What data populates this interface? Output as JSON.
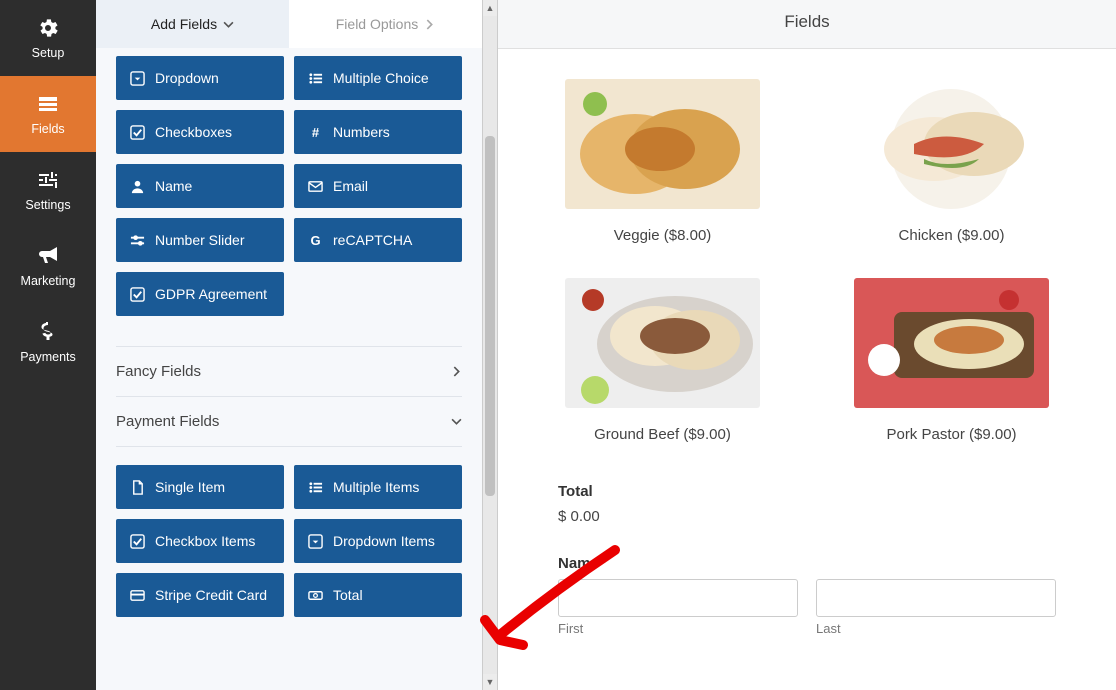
{
  "nav": [
    {
      "icon": "gear",
      "label": "Setup"
    },
    {
      "icon": "fields",
      "label": "Fields"
    },
    {
      "icon": "sliders",
      "label": "Settings"
    },
    {
      "icon": "bullhorn",
      "label": "Marketing"
    },
    {
      "icon": "dollar",
      "label": "Payments"
    }
  ],
  "tabs": {
    "add": "Add Fields",
    "options": "Field Options"
  },
  "field_buttons_top": [
    {
      "icon": "caret",
      "label": "Dropdown"
    },
    {
      "icon": "list",
      "label": "Multiple Choice"
    },
    {
      "icon": "check",
      "label": "Checkboxes"
    },
    {
      "icon": "hash",
      "label": "Numbers"
    },
    {
      "icon": "user",
      "label": "Name"
    },
    {
      "icon": "mail",
      "label": "Email"
    },
    {
      "icon": "slider",
      "label": "Number Slider"
    },
    {
      "icon": "g",
      "label": "reCAPTCHA"
    },
    {
      "icon": "check",
      "label": "GDPR Agreement"
    }
  ],
  "sections": {
    "fancy": "Fancy Fields",
    "payment": "Payment Fields"
  },
  "payment_buttons": [
    {
      "icon": "doc",
      "label": "Single Item"
    },
    {
      "icon": "list",
      "label": "Multiple Items"
    },
    {
      "icon": "check",
      "label": "Checkbox Items"
    },
    {
      "icon": "caret",
      "label": "Dropdown Items"
    },
    {
      "icon": "card",
      "label": "Stripe Credit Card"
    },
    {
      "icon": "money",
      "label": "Total"
    }
  ],
  "preview": {
    "title": "Fields",
    "items": [
      {
        "label": "Veggie ($8.00)",
        "colors": [
          "#e6b56a",
          "#c47a2e",
          "#8fbf4f"
        ]
      },
      {
        "label": "Chicken ($9.00)",
        "colors": [
          "#f5e9d6",
          "#d0b97e",
          "#cc5b3f"
        ]
      },
      {
        "label": "Ground Beef ($9.00)",
        "colors": [
          "#8a5a3b",
          "#6a9a4f",
          "#d7d2cc"
        ]
      },
      {
        "label": "Pork Pastor ($9.00)",
        "colors": [
          "#d33a3a",
          "#eadfb8",
          "#8a5a3b"
        ]
      }
    ],
    "total_label": "Total",
    "total_value": "$ 0.00",
    "name_label": "Name",
    "first_label": "First",
    "last_label": "Last"
  }
}
